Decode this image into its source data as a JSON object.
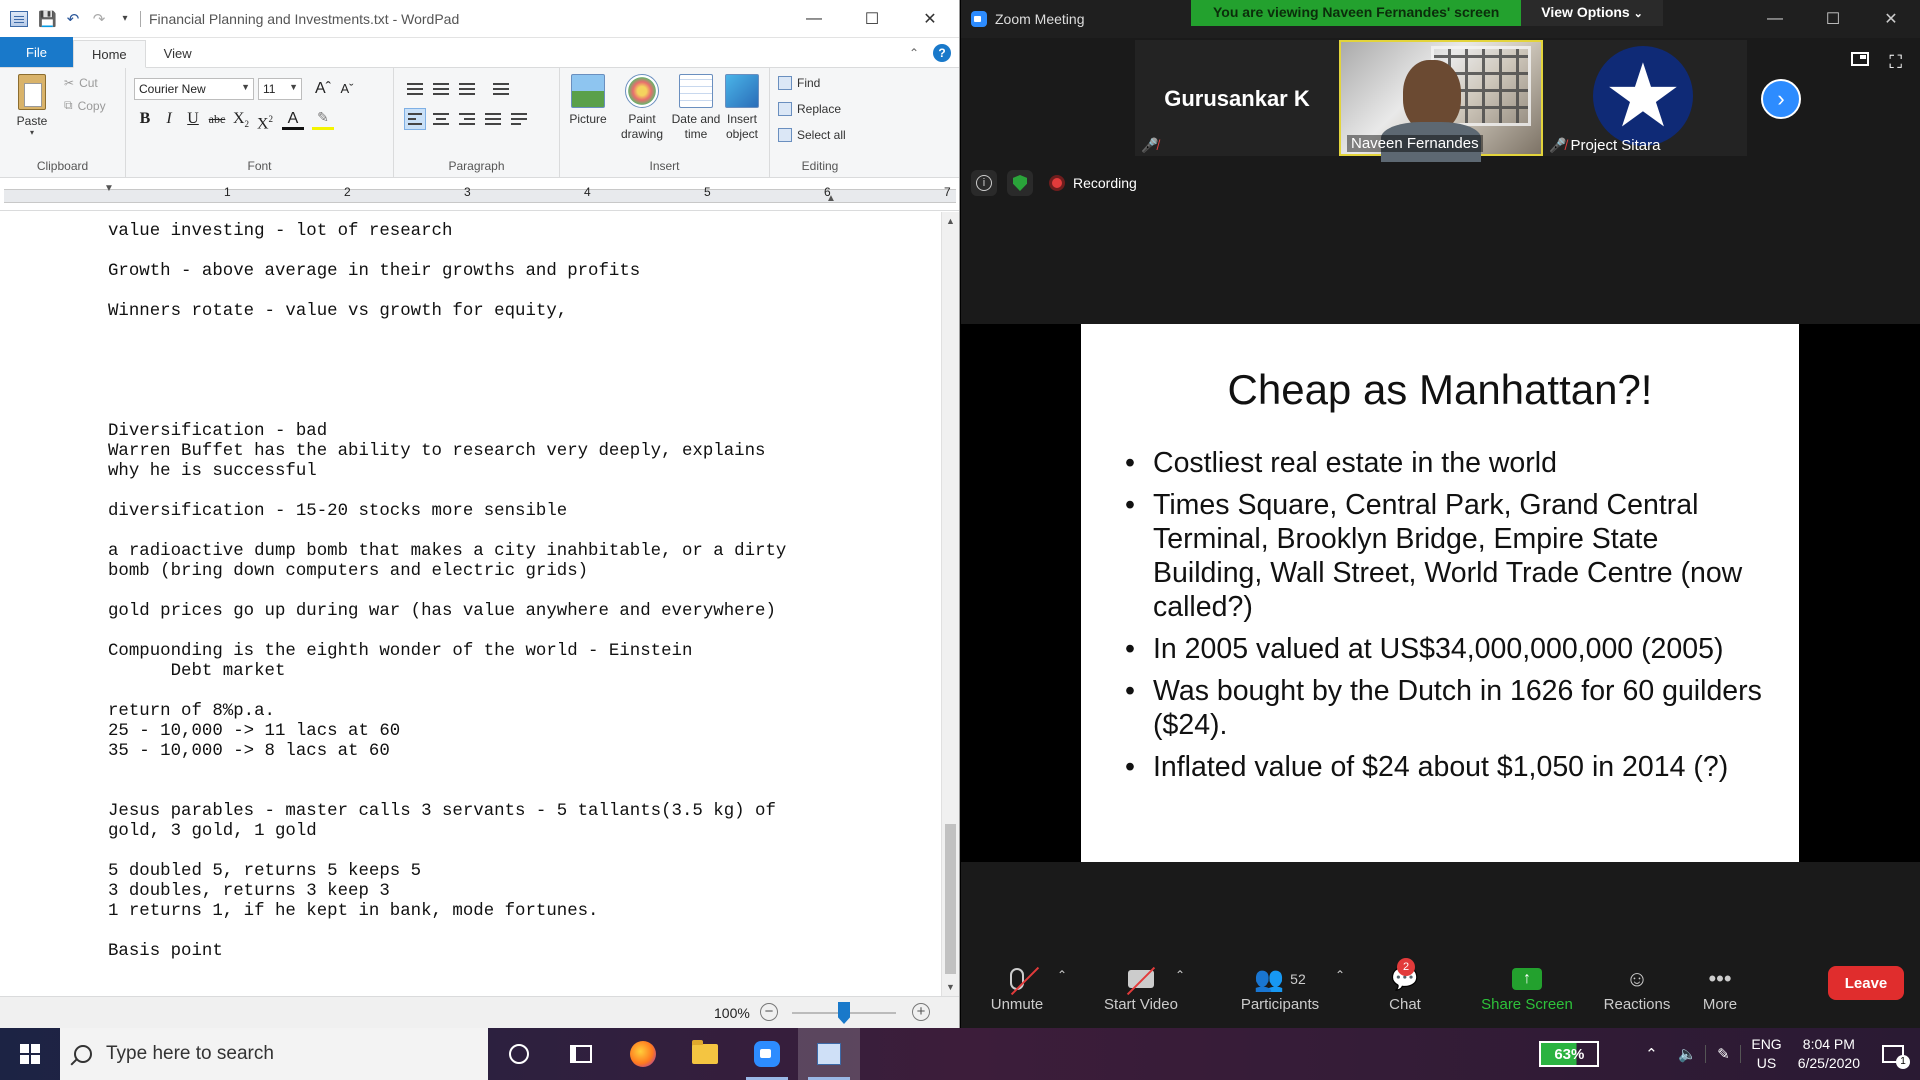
{
  "wordpad": {
    "title": "Financial Planning and Investments.txt - WordPad",
    "tabs": [
      "File",
      "Home",
      "View"
    ],
    "clipboard": {
      "paste": "Paste",
      "cut": "Cut",
      "copy": "Copy",
      "group": "Clipboard"
    },
    "font": {
      "name": "Courier New",
      "size": "11",
      "group": "Font"
    },
    "paragraph": {
      "group": "Paragraph"
    },
    "insert": {
      "picture": "Picture",
      "paint": "Paint drawing",
      "datetime": "Date and time",
      "object": "Insert object",
      "group": "Insert"
    },
    "editing": {
      "find": "Find",
      "replace": "Replace",
      "select_all": "Select all",
      "group": "Editing"
    },
    "ruler_numbers": [
      "1",
      "2",
      "3",
      "4",
      "5",
      "6",
      "7"
    ],
    "document_lines": [
      "value investing - lot of research",
      "",
      "Growth - above average in their growths and profits",
      "",
      "Winners rotate - value vs growth for equity,",
      "",
      "",
      "",
      "",
      "",
      "Diversification - bad",
      "Warren Buffet has the ability to research very deeply, explains",
      "why he is successful",
      "",
      "diversification - 15-20 stocks more sensible",
      "",
      "a radioactive dump bomb that makes a city inahbitable, or a dirty",
      "bomb (bring down computers and electric grids)",
      "",
      "gold prices go up during war (has value anywhere and everywhere)",
      "",
      "Compuonding is the eighth wonder of the world - Einstein",
      "      Debt market",
      "",
      "return of 8%p.a.",
      "25 - 10,000 -> 11 lacs at 60",
      "35 - 10,000 -> 8 lacs at 60",
      "",
      "",
      "Jesus parables - master calls 3 servants - 5 tallants(3.5 kg) of",
      "gold, 3 gold, 1 gold",
      "",
      "5 doubled 5, returns 5 keeps 5",
      "3 doubles, returns 3 keep 3",
      "1 returns 1, if he kept in bank, mode fortunes.",
      "",
      "Basis point"
    ],
    "zoom_level": "100%",
    "zoom_fraction": 0.5
  },
  "zoom": {
    "title": "Zoom Meeting",
    "banner": "You are viewing Naveen Fernandes' screen",
    "view_options": "View Options",
    "participants_strip": [
      {
        "name": "Gurusankar K",
        "muted": true
      },
      {
        "name": "Naveen Fernandes",
        "muted": false,
        "active": true
      },
      {
        "name": "Project Sitara",
        "muted": true
      }
    ],
    "recording": "Recording",
    "slide": {
      "title": "Cheap as Manhattan?!",
      "bullets": [
        "Costliest real estate in the world",
        "Times Square, Central Park, Grand Central Terminal, Brooklyn Bridge, Empire State Building, Wall Street, World Trade Centre (now called?)",
        "In 2005 valued at US$34,000,000,000 (2005)",
        "Was bought by the Dutch in 1626 for 60 guilders ($24).",
        "Inflated value of $24 about $1,050 in 2014 (?)"
      ]
    },
    "toolbar": {
      "unmute": "Unmute",
      "start_video": "Start Video",
      "participants": "Participants",
      "participants_count": "52",
      "chat": "Chat",
      "chat_badge": "2",
      "share_screen": "Share Screen",
      "reactions": "Reactions",
      "more": "More",
      "leave": "Leave"
    }
  },
  "taskbar": {
    "search_placeholder": "Type here to search",
    "battery": "63%",
    "battery_level": 0.63,
    "lang1": "ENG",
    "lang2": "US",
    "time": "8:04 PM",
    "date": "6/25/2020",
    "notifications": "1"
  }
}
